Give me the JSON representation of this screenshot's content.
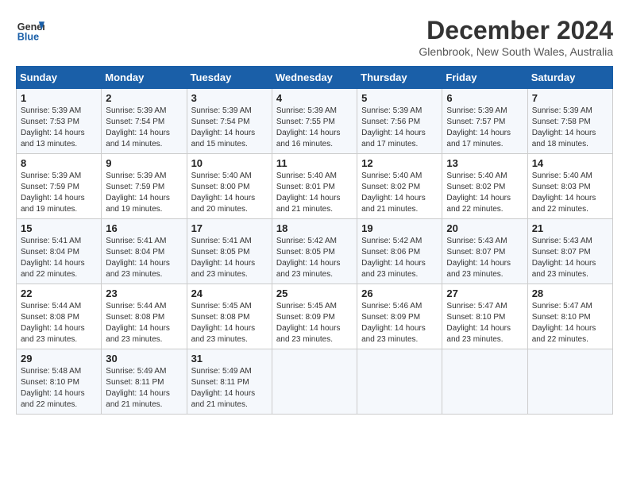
{
  "header": {
    "logo_line1": "General",
    "logo_line2": "Blue",
    "title": "December 2024",
    "subtitle": "Glenbrook, New South Wales, Australia"
  },
  "weekdays": [
    "Sunday",
    "Monday",
    "Tuesday",
    "Wednesday",
    "Thursday",
    "Friday",
    "Saturday"
  ],
  "weeks": [
    [
      {
        "day": 1,
        "rise": "5:39 AM",
        "set": "7:53 PM",
        "daylight": "14 hours and 13 minutes."
      },
      {
        "day": 2,
        "rise": "5:39 AM",
        "set": "7:54 PM",
        "daylight": "14 hours and 14 minutes."
      },
      {
        "day": 3,
        "rise": "5:39 AM",
        "set": "7:54 PM",
        "daylight": "14 hours and 15 minutes."
      },
      {
        "day": 4,
        "rise": "5:39 AM",
        "set": "7:55 PM",
        "daylight": "14 hours and 16 minutes."
      },
      {
        "day": 5,
        "rise": "5:39 AM",
        "set": "7:56 PM",
        "daylight": "14 hours and 17 minutes."
      },
      {
        "day": 6,
        "rise": "5:39 AM",
        "set": "7:57 PM",
        "daylight": "14 hours and 17 minutes."
      },
      {
        "day": 7,
        "rise": "5:39 AM",
        "set": "7:58 PM",
        "daylight": "14 hours and 18 minutes."
      }
    ],
    [
      {
        "day": 8,
        "rise": "5:39 AM",
        "set": "7:59 PM",
        "daylight": "14 hours and 19 minutes."
      },
      {
        "day": 9,
        "rise": "5:39 AM",
        "set": "7:59 PM",
        "daylight": "14 hours and 19 minutes."
      },
      {
        "day": 10,
        "rise": "5:40 AM",
        "set": "8:00 PM",
        "daylight": "14 hours and 20 minutes."
      },
      {
        "day": 11,
        "rise": "5:40 AM",
        "set": "8:01 PM",
        "daylight": "14 hours and 21 minutes."
      },
      {
        "day": 12,
        "rise": "5:40 AM",
        "set": "8:02 PM",
        "daylight": "14 hours and 21 minutes."
      },
      {
        "day": 13,
        "rise": "5:40 AM",
        "set": "8:02 PM",
        "daylight": "14 hours and 22 minutes."
      },
      {
        "day": 14,
        "rise": "5:40 AM",
        "set": "8:03 PM",
        "daylight": "14 hours and 22 minutes."
      }
    ],
    [
      {
        "day": 15,
        "rise": "5:41 AM",
        "set": "8:04 PM",
        "daylight": "14 hours and 22 minutes."
      },
      {
        "day": 16,
        "rise": "5:41 AM",
        "set": "8:04 PM",
        "daylight": "14 hours and 23 minutes."
      },
      {
        "day": 17,
        "rise": "5:41 AM",
        "set": "8:05 PM",
        "daylight": "14 hours and 23 minutes."
      },
      {
        "day": 18,
        "rise": "5:42 AM",
        "set": "8:05 PM",
        "daylight": "14 hours and 23 minutes."
      },
      {
        "day": 19,
        "rise": "5:42 AM",
        "set": "8:06 PM",
        "daylight": "14 hours and 23 minutes."
      },
      {
        "day": 20,
        "rise": "5:43 AM",
        "set": "8:07 PM",
        "daylight": "14 hours and 23 minutes."
      },
      {
        "day": 21,
        "rise": "5:43 AM",
        "set": "8:07 PM",
        "daylight": "14 hours and 23 minutes."
      }
    ],
    [
      {
        "day": 22,
        "rise": "5:44 AM",
        "set": "8:08 PM",
        "daylight": "14 hours and 23 minutes."
      },
      {
        "day": 23,
        "rise": "5:44 AM",
        "set": "8:08 PM",
        "daylight": "14 hours and 23 minutes."
      },
      {
        "day": 24,
        "rise": "5:45 AM",
        "set": "8:08 PM",
        "daylight": "14 hours and 23 minutes."
      },
      {
        "day": 25,
        "rise": "5:45 AM",
        "set": "8:09 PM",
        "daylight": "14 hours and 23 minutes."
      },
      {
        "day": 26,
        "rise": "5:46 AM",
        "set": "8:09 PM",
        "daylight": "14 hours and 23 minutes."
      },
      {
        "day": 27,
        "rise": "5:47 AM",
        "set": "8:10 PM",
        "daylight": "14 hours and 23 minutes."
      },
      {
        "day": 28,
        "rise": "5:47 AM",
        "set": "8:10 PM",
        "daylight": "14 hours and 22 minutes."
      }
    ],
    [
      {
        "day": 29,
        "rise": "5:48 AM",
        "set": "8:10 PM",
        "daylight": "14 hours and 22 minutes."
      },
      {
        "day": 30,
        "rise": "5:49 AM",
        "set": "8:11 PM",
        "daylight": "14 hours and 21 minutes."
      },
      {
        "day": 31,
        "rise": "5:49 AM",
        "set": "8:11 PM",
        "daylight": "14 hours and 21 minutes."
      },
      null,
      null,
      null,
      null
    ]
  ]
}
